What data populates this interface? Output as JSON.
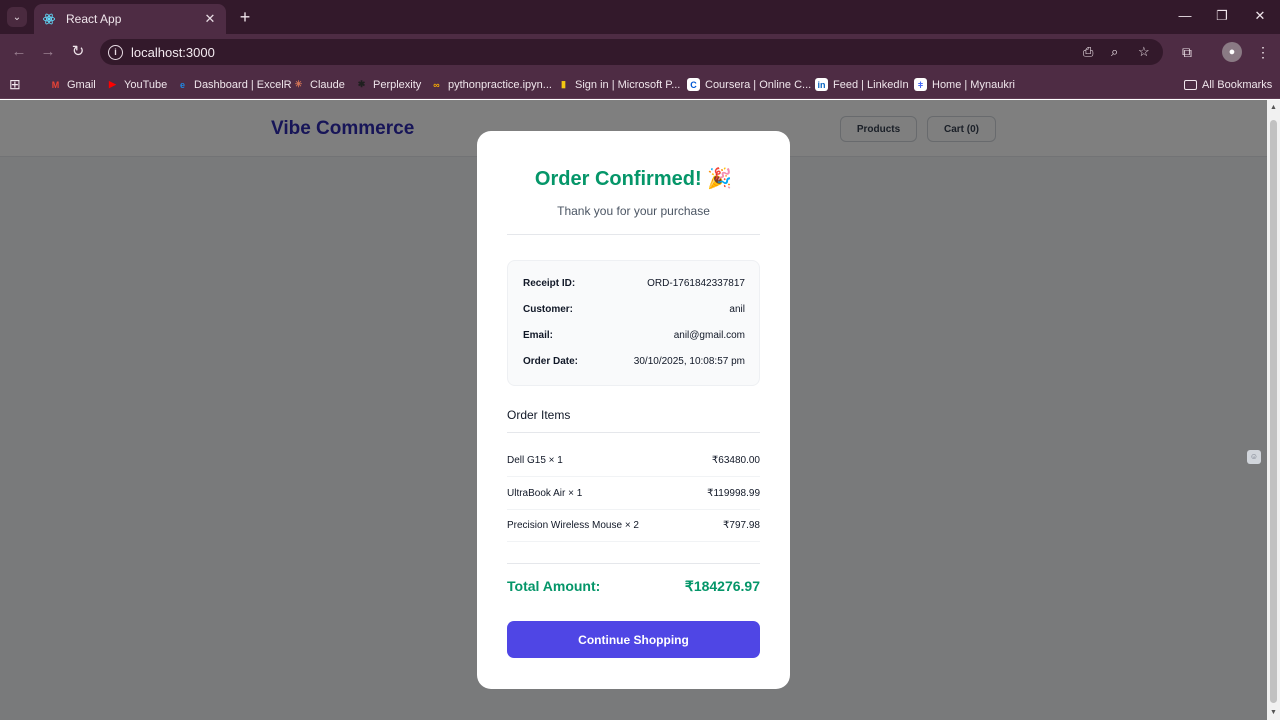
{
  "browser": {
    "tab_title": "React App",
    "tab_close": "✕",
    "new_tab": "+",
    "url": "localhost:3000",
    "window": {
      "minimize": "—",
      "restore": "❐",
      "close": "✕"
    },
    "bookmarks": [
      {
        "label": "Gmail",
        "icon": "gmail-icon",
        "glyph": "M",
        "color": "#ea4335"
      },
      {
        "label": "YouTube",
        "icon": "youtube-icon",
        "glyph": "▶",
        "color": "#ff0000"
      },
      {
        "label": "Dashboard | ExcelR",
        "icon": "excelr-icon",
        "glyph": "e",
        "color": "#1e88e5"
      },
      {
        "label": "Claude",
        "icon": "claude-icon",
        "glyph": "✳",
        "color": "#d97757"
      },
      {
        "label": "Perplexity",
        "icon": "perplexity-icon",
        "glyph": "✱",
        "color": "#1f1f1f"
      },
      {
        "label": "pythonpractice.ipyn...",
        "icon": "colab-icon",
        "glyph": "∞",
        "color": "#f9ab00"
      },
      {
        "label": "Sign in | Microsoft P...",
        "icon": "powerbi-icon",
        "glyph": "▮",
        "color": "#f2c811"
      },
      {
        "label": "Coursera | Online C...",
        "icon": "coursera-icon",
        "glyph": "C",
        "color": "#0056d2"
      },
      {
        "label": "Feed | LinkedIn",
        "icon": "linkedin-icon",
        "glyph": "in",
        "color": "#0a66c2"
      },
      {
        "label": "Home | Mynaukri",
        "icon": "naukri-icon",
        "glyph": "ǂ",
        "color": "#4a6cf7"
      }
    ],
    "all_bookmarks": "All Bookmarks"
  },
  "site": {
    "brand": "Vibe Commerce",
    "nav_products": "Products",
    "nav_cart": "Cart (0)"
  },
  "modal": {
    "title": "Order Confirmed! 🎉",
    "subtitle": "Thank you for your purchase",
    "receipt": [
      {
        "label": "Receipt ID:",
        "value": "ORD-1761842337817"
      },
      {
        "label": "Customer:",
        "value": "anil"
      },
      {
        "label": "Email:",
        "value": "anil@gmail.com"
      },
      {
        "label": "Order Date:",
        "value": "30/10/2025, 10:08:57 pm"
      }
    ],
    "items_heading": "Order Items",
    "items": [
      {
        "name": "Dell G15 × 1",
        "price": "₹63480.00"
      },
      {
        "name": "UltraBook Air × 1",
        "price": "₹119998.99"
      },
      {
        "name": "Precision Wireless Mouse × 2",
        "price": "₹797.98"
      }
    ],
    "total_label": "Total Amount:",
    "total_value": "₹184276.97",
    "cta": "Continue Shopping"
  },
  "colors": {
    "accent": "#4f46e5",
    "success": "#059669",
    "brand": "#2f2ab0",
    "chrome": "#4e2c44"
  }
}
